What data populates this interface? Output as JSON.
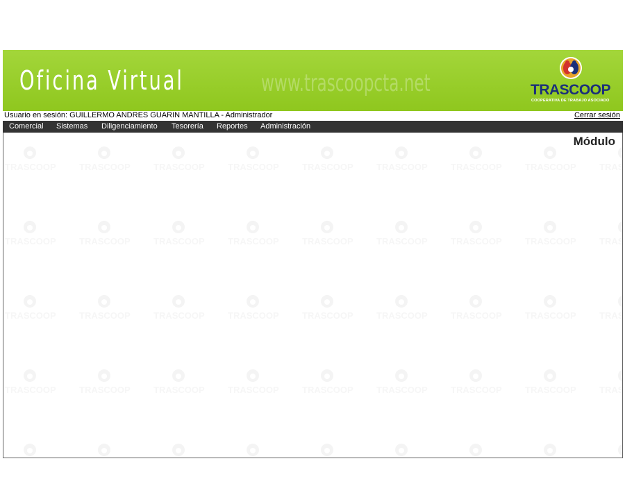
{
  "header": {
    "title": "Oficina Virtual",
    "watermark_url": "www.trascoopcta.net",
    "logo": {
      "name": "TRASCOOP",
      "tagline": "COOPERATIVA DE TRABAJO ASOCIADO"
    }
  },
  "session": {
    "user_text": "Usuario en sesión: GUILLERMO ANDRES GUARIN MANTILLA - Administrador",
    "logout_label": "Cerrar sesión"
  },
  "menu": {
    "items": [
      {
        "label": "Comercial"
      },
      {
        "label": "Sistemas"
      },
      {
        "label": "Diligenciamiento"
      },
      {
        "label": "Tesorería"
      },
      {
        "label": "Reportes"
      },
      {
        "label": "Administración"
      }
    ]
  },
  "content": {
    "module_title": "Módulo",
    "background_watermark": "TRASCOOP"
  },
  "colors": {
    "banner_green": "#9acd2d",
    "menu_bar": "#333333",
    "logo_blue": "#1a2f7a",
    "logo_red": "#d2322d"
  }
}
